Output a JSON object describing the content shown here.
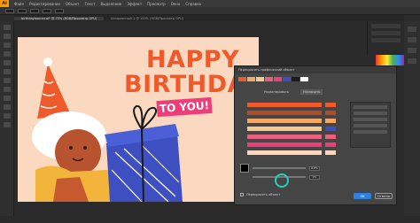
{
  "app": {
    "logo": "Ai"
  },
  "menu": [
    "Файл",
    "Редактирование",
    "Объект",
    "Текст",
    "Выделение",
    "Эффект",
    "Просмотр",
    "Окно",
    "Справка"
  ],
  "tabs": [
    {
      "label": "birthdaybanner.ai* @ 75% (RGB/Просмотр GPU)",
      "active": true
    },
    {
      "label": "Безымянный-1 @ 100% (RGB/Просмотр GPU)",
      "active": false
    }
  ],
  "artwork": {
    "line1": "HAPPY",
    "line2": "BIRTHDAY",
    "banner": "TO YOU!"
  },
  "dialog": {
    "title": "Перекрасить графический объект",
    "tabs": [
      "Редактировать",
      "Назначить"
    ],
    "row_colors": [
      "#ef5a2c",
      "#b34a2a",
      "#f2a765",
      "#f7c98f",
      "#e9607f",
      "#ef3d7a",
      "#fbd9c0"
    ],
    "swatch_colors": [
      "#ef5a2c",
      "#f2a765",
      "#f7c98f",
      "#e9607f",
      "#ef3d7a",
      "#3d4fc1",
      "#1b1b1b",
      "#ffffff"
    ],
    "slider_values": [
      "0,8%",
      "0%"
    ],
    "checkbox_label": "Перекрасить объект",
    "ok_label": "OK",
    "cancel_label": "Отмена"
  }
}
